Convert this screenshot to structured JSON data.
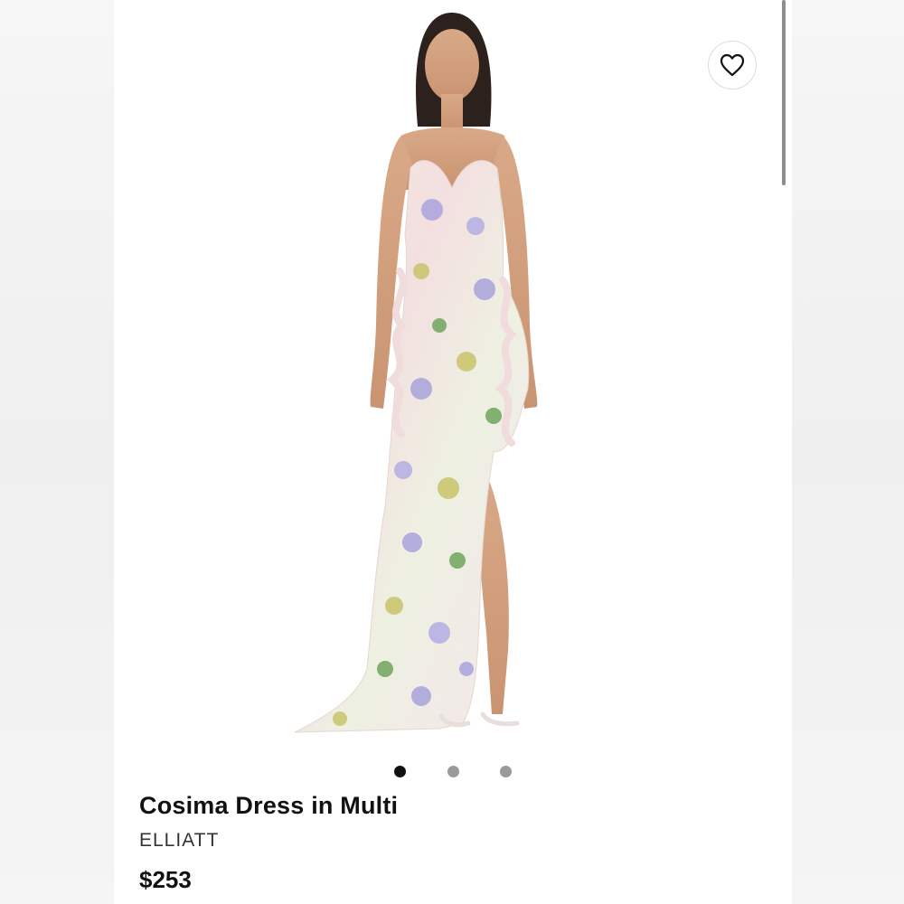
{
  "product": {
    "title": "Cosima Dress in Multi",
    "brand": "ELLIATT",
    "price": "$253",
    "image_alt": "Cosima Dress in Multi"
  },
  "wishlist": {
    "icon": "heart-icon"
  },
  "carousel": {
    "total_images": 3,
    "active_index": 0
  },
  "colors": {
    "active_dot": "#111111",
    "inactive_dot": "#9a9a9a",
    "text": "#111111"
  }
}
